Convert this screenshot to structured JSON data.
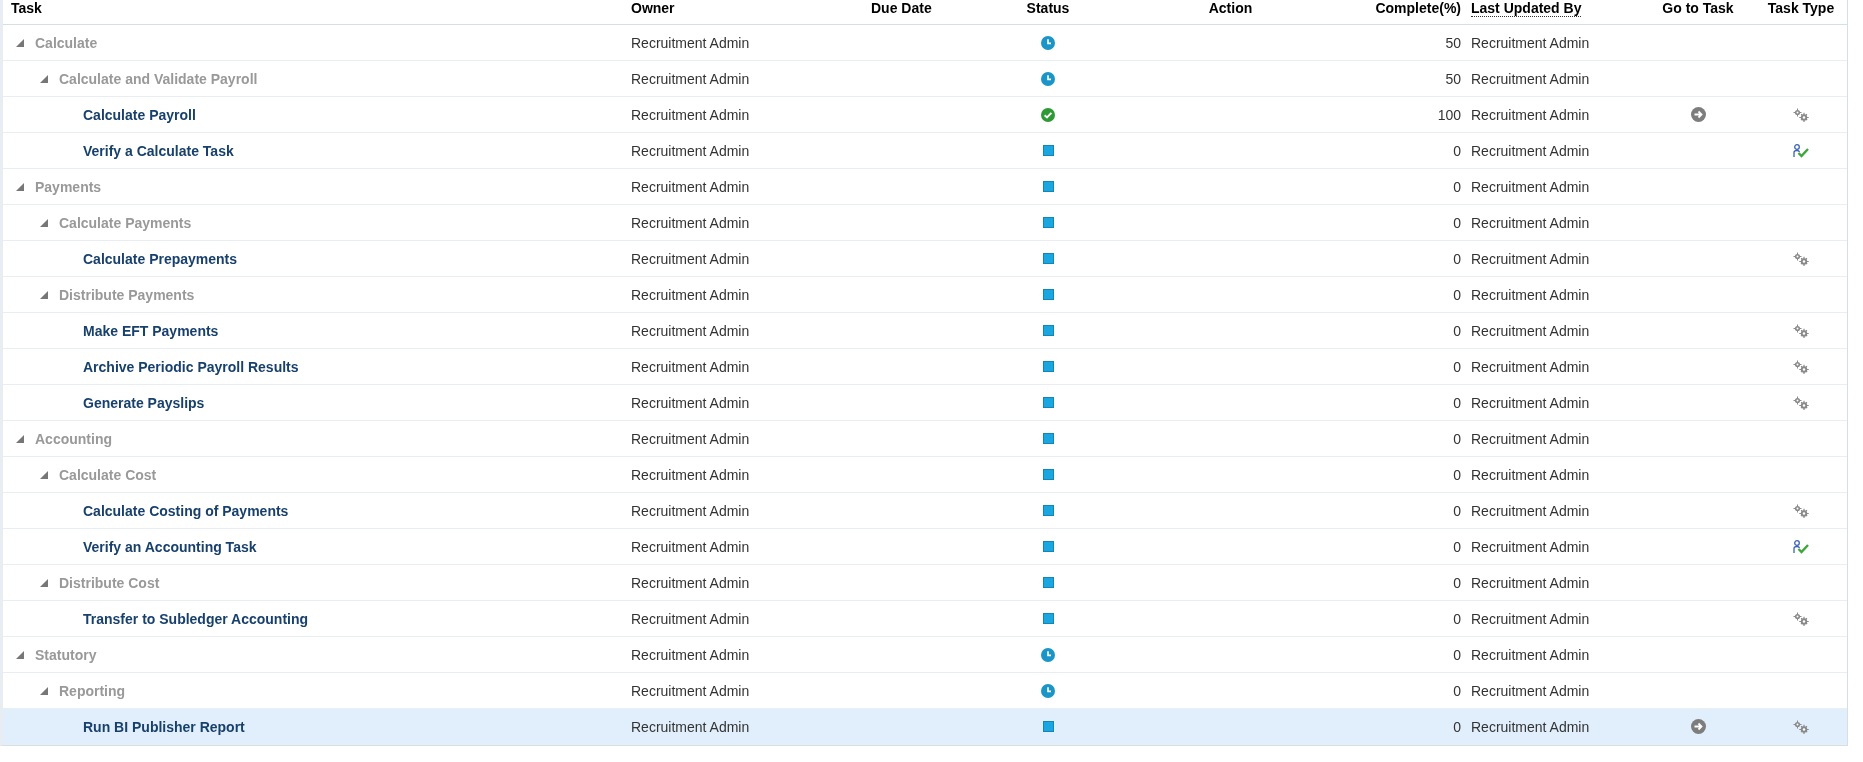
{
  "table": {
    "columns": [
      {
        "label": "Task"
      },
      {
        "label": "Owner"
      },
      {
        "label": "Due Date"
      },
      {
        "label": "Status"
      },
      {
        "label": "Action"
      },
      {
        "label": "Complete(%)"
      },
      {
        "label": "Last Updated By"
      },
      {
        "label": "Go to Task"
      },
      {
        "label": "Task Type"
      }
    ],
    "rows": [
      {
        "task": "Calculate",
        "expanded": true,
        "selected": false,
        "owner": "Recruitment Admin",
        "status": {
          "kind": "in-progress"
        },
        "complete": "50",
        "last_updated_by": "Recruitment Admin",
        "children": [
          {
            "task": "Calculate and Validate Payroll",
            "expanded": true,
            "selected": false,
            "owner": "Recruitment Admin",
            "status": {
              "kind": "in-progress"
            },
            "complete": "50",
            "last_updated_by": "Recruitment Admin",
            "children": [
              {
                "task": "Calculate Payroll",
                "selected": false,
                "owner": "Recruitment Admin",
                "status": {
                  "kind": "completed"
                },
                "complete": "100",
                "last_updated_by": "Recruitment Admin",
                "go_to_task": true,
                "task_type": {
                  "kind": "process"
                }
              },
              {
                "task": "Verify a Calculate Task",
                "selected": false,
                "owner": "Recruitment Admin",
                "status": {
                  "kind": "not-started"
                },
                "complete": "0",
                "last_updated_by": "Recruitment Admin",
                "go_to_task": false,
                "task_type": {
                  "kind": "verification"
                }
              }
            ]
          }
        ]
      },
      {
        "task": "Payments",
        "expanded": true,
        "selected": false,
        "owner": "Recruitment Admin",
        "status": {
          "kind": "not-started"
        },
        "complete": "0",
        "last_updated_by": "Recruitment Admin",
        "children": [
          {
            "task": "Calculate Payments",
            "expanded": true,
            "selected": false,
            "owner": "Recruitment Admin",
            "status": {
              "kind": "not-started"
            },
            "complete": "0",
            "last_updated_by": "Recruitment Admin",
            "children": [
              {
                "task": "Calculate Prepayments",
                "selected": false,
                "owner": "Recruitment Admin",
                "status": {
                  "kind": "not-started"
                },
                "complete": "0",
                "last_updated_by": "Recruitment Admin",
                "go_to_task": false,
                "task_type": {
                  "kind": "process"
                }
              }
            ]
          },
          {
            "task": "Distribute Payments",
            "expanded": true,
            "selected": false,
            "owner": "Recruitment Admin",
            "status": {
              "kind": "not-started"
            },
            "complete": "0",
            "last_updated_by": "Recruitment Admin",
            "children": [
              {
                "task": "Make EFT Payments",
                "selected": false,
                "owner": "Recruitment Admin",
                "status": {
                  "kind": "not-started"
                },
                "complete": "0",
                "last_updated_by": "Recruitment Admin",
                "go_to_task": false,
                "task_type": {
                  "kind": "process"
                }
              },
              {
                "task": "Archive Periodic Payroll Results",
                "selected": false,
                "owner": "Recruitment Admin",
                "status": {
                  "kind": "not-started"
                },
                "complete": "0",
                "last_updated_by": "Recruitment Admin",
                "go_to_task": false,
                "task_type": {
                  "kind": "process"
                }
              },
              {
                "task": "Generate Payslips",
                "selected": false,
                "owner": "Recruitment Admin",
                "status": {
                  "kind": "not-started"
                },
                "complete": "0",
                "last_updated_by": "Recruitment Admin",
                "go_to_task": false,
                "task_type": {
                  "kind": "process"
                }
              }
            ]
          }
        ]
      },
      {
        "task": "Accounting",
        "expanded": true,
        "selected": false,
        "owner": "Recruitment Admin",
        "status": {
          "kind": "not-started"
        },
        "complete": "0",
        "last_updated_by": "Recruitment Admin",
        "children": [
          {
            "task": "Calculate Cost",
            "expanded": true,
            "selected": false,
            "owner": "Recruitment Admin",
            "status": {
              "kind": "not-started"
            },
            "complete": "0",
            "last_updated_by": "Recruitment Admin",
            "children": [
              {
                "task": "Calculate Costing of Payments",
                "selected": false,
                "owner": "Recruitment Admin",
                "status": {
                  "kind": "not-started"
                },
                "complete": "0",
                "last_updated_by": "Recruitment Admin",
                "go_to_task": false,
                "task_type": {
                  "kind": "process"
                }
              },
              {
                "task": "Verify an Accounting Task",
                "selected": false,
                "owner": "Recruitment Admin",
                "status": {
                  "kind": "not-started"
                },
                "complete": "0",
                "last_updated_by": "Recruitment Admin",
                "go_to_task": false,
                "task_type": {
                  "kind": "verification"
                }
              }
            ]
          },
          {
            "task": "Distribute Cost",
            "expanded": true,
            "selected": false,
            "owner": "Recruitment Admin",
            "status": {
              "kind": "not-started"
            },
            "complete": "0",
            "last_updated_by": "Recruitment Admin",
            "children": [
              {
                "task": "Transfer to Subledger Accounting",
                "selected": false,
                "owner": "Recruitment Admin",
                "status": {
                  "kind": "not-started"
                },
                "complete": "0",
                "last_updated_by": "Recruitment Admin",
                "go_to_task": false,
                "task_type": {
                  "kind": "process"
                }
              }
            ]
          }
        ]
      },
      {
        "task": "Statutory",
        "expanded": true,
        "selected": false,
        "owner": "Recruitment Admin",
        "status": {
          "kind": "in-progress"
        },
        "complete": "0",
        "last_updated_by": "Recruitment Admin",
        "children": [
          {
            "task": "Reporting",
            "expanded": true,
            "selected": false,
            "owner": "Recruitment Admin",
            "status": {
              "kind": "in-progress"
            },
            "complete": "0",
            "last_updated_by": "Recruitment Admin",
            "children": [
              {
                "task": "Run BI Publisher Report",
                "selected": true,
                "owner": "Recruitment Admin",
                "status": {
                  "kind": "not-started"
                },
                "complete": "0",
                "last_updated_by": "Recruitment Admin",
                "go_to_task": true,
                "task_type": {
                  "kind": "process"
                }
              }
            ]
          }
        ]
      }
    ]
  }
}
